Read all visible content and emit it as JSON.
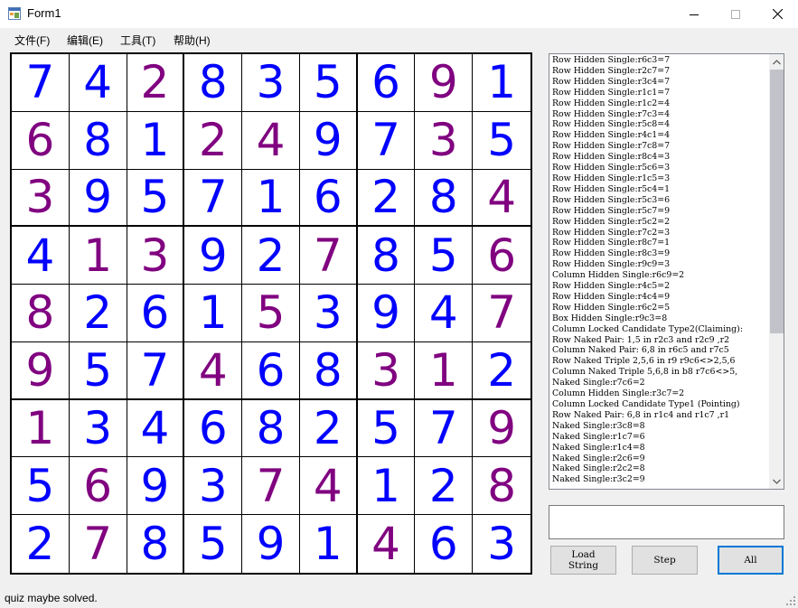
{
  "window": {
    "title": "Form1"
  },
  "menu": [
    "文件(F)",
    "编辑(E)",
    "工具(T)",
    "帮助(H)"
  ],
  "board": {
    "given_color": "#800080",
    "solved_color": "#0000ff",
    "rows": [
      [
        7,
        4,
        2,
        8,
        3,
        5,
        6,
        9,
        1
      ],
      [
        6,
        8,
        1,
        2,
        4,
        9,
        7,
        3,
        5
      ],
      [
        3,
        9,
        5,
        7,
        1,
        6,
        2,
        8,
        4
      ],
      [
        4,
        1,
        3,
        9,
        2,
        7,
        8,
        5,
        6
      ],
      [
        8,
        2,
        6,
        1,
        5,
        3,
        9,
        4,
        7
      ],
      [
        9,
        5,
        7,
        4,
        6,
        8,
        3,
        1,
        2
      ],
      [
        1,
        3,
        4,
        6,
        8,
        2,
        5,
        7,
        9
      ],
      [
        5,
        6,
        9,
        3,
        7,
        4,
        1,
        2,
        8
      ],
      [
        2,
        7,
        8,
        5,
        9,
        1,
        4,
        6,
        3
      ]
    ],
    "given": [
      [
        0,
        0,
        1,
        0,
        0,
        0,
        0,
        1,
        0
      ],
      [
        1,
        0,
        0,
        1,
        1,
        0,
        0,
        1,
        0
      ],
      [
        1,
        0,
        0,
        0,
        0,
        0,
        0,
        0,
        1
      ],
      [
        0,
        1,
        1,
        0,
        0,
        1,
        0,
        0,
        1
      ],
      [
        1,
        0,
        0,
        0,
        1,
        0,
        0,
        0,
        1
      ],
      [
        1,
        0,
        0,
        1,
        0,
        0,
        1,
        1,
        0
      ],
      [
        1,
        0,
        0,
        0,
        0,
        0,
        0,
        0,
        1
      ],
      [
        0,
        1,
        0,
        0,
        1,
        1,
        0,
        0,
        1
      ],
      [
        0,
        1,
        0,
        0,
        0,
        0,
        1,
        0,
        0
      ]
    ]
  },
  "log": [
    "Row Hidden Single:r6c3=7",
    "Row Hidden Single:r2c7=7",
    "Row Hidden Single:r3c4=7",
    "Row Hidden Single:r1c1=7",
    "Row Hidden Single:r1c2=4",
    "Row Hidden Single:r7c3=4",
    "Row Hidden Single:r5c8=4",
    "Row Hidden Single:r4c1=4",
    "Row Hidden Single:r7c8=7",
    "Row Hidden Single:r8c4=3",
    "Row Hidden Single:r5c6=3",
    "Row Hidden Single:r1c5=3",
    "Row Hidden Single:r5c4=1",
    "Row Hidden Single:r5c3=6",
    "Row Hidden Single:r5c7=9",
    "Row Hidden Single:r5c2=2",
    "Row Hidden Single:r7c2=3",
    "Row Hidden Single:r8c7=1",
    "Row Hidden Single:r8c3=9",
    "Row Hidden Single:r9c9=3",
    "Column Hidden Single:r6c9=2",
    "Row Hidden Single:r4c5=2",
    "Row Hidden Single:r4c4=9",
    "Row Hidden Single:r6c2=5",
    "Box Hidden Single:r9c3=8",
    "Column Locked Candidate Type2(Claiming):",
    "Row Naked Pair: 1,5 in r2c3 and r2c9 ,r2",
    "Column Naked Pair: 6,8 in r6c5 and r7c5",
    "Row Naked Triple 2,5,6 in r9 r9c6<>2,5,6",
    "Column Naked Triple 5,6,8 in b8 r7c6<>5,",
    "Naked Single:r7c6=2",
    "Column Hidden Single:r3c7=2",
    "Column Locked Candidate Type1 (Pointing)",
    "Row Naked Pair: 6,8 in r1c4 and r1c7 ,r1",
    "Naked Single:r3c8=8",
    "Naked Single:r1c7=6",
    "Naked Single:r1c4=8",
    "Naked Single:r2c6=9",
    "Naked Single:r2c2=8",
    "Naked Single:r3c2=9"
  ],
  "input": {
    "value": ""
  },
  "buttons": {
    "load": "Load\nString",
    "step": "Step",
    "all": "All"
  },
  "status": "quiz maybe solved."
}
